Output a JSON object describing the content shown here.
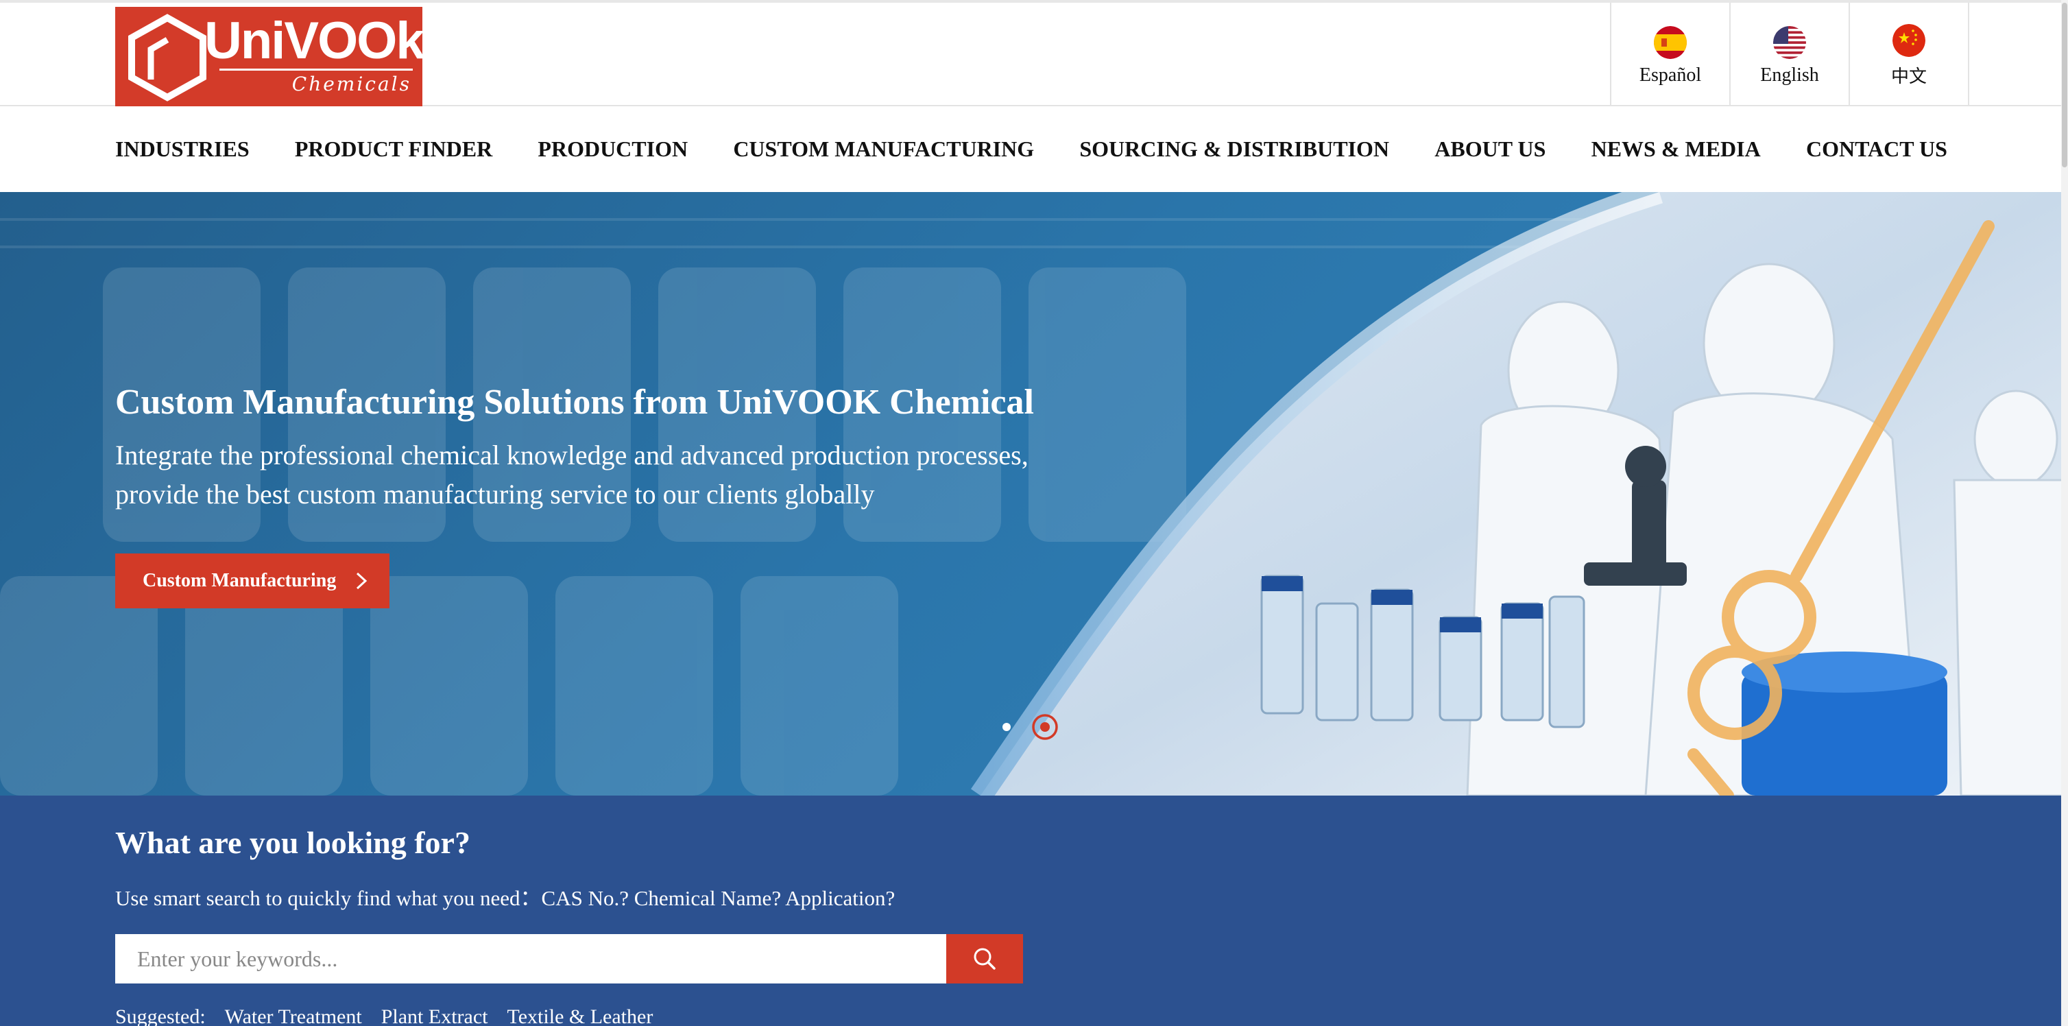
{
  "logo": {
    "word": "UniVOOk",
    "sub": "Chemicals"
  },
  "languages": [
    {
      "label": "Español",
      "flag": "spain-flag-icon"
    },
    {
      "label": "English",
      "flag": "usa-flag-icon"
    },
    {
      "label": "中文",
      "flag": "china-flag-icon"
    }
  ],
  "nav": [
    "INDUSTRIES",
    "PRODUCT FINDER",
    "PRODUCTION",
    "CUSTOM MANUFACTURING",
    "SOURCING & DISTRIBUTION",
    "ABOUT US",
    "NEWS & MEDIA",
    "CONTACT US"
  ],
  "hero": {
    "title": "Custom Manufacturing Solutions from UniVOOK Chemical",
    "text": "Integrate the professional chemical knowledge and advanced production processes, provide the best custom manufacturing service to our clients globally",
    "button": "Custom Manufacturing",
    "slide_count": 2,
    "active_slide": 2
  },
  "search": {
    "title": "What are you looking for?",
    "subtitle": "Use smart search to quickly find what you need：CAS No.? Chemical Name? Application?",
    "placeholder": "Enter your keywords...",
    "value": "",
    "suggested_label": "Suggested:",
    "suggested": [
      "Water Treatment",
      "Plant Extract",
      "Textile & Leather"
    ]
  },
  "colors": {
    "brand_red": "#d23a27",
    "hero_blue": "#2a75aa",
    "search_band": "#2c5190"
  }
}
